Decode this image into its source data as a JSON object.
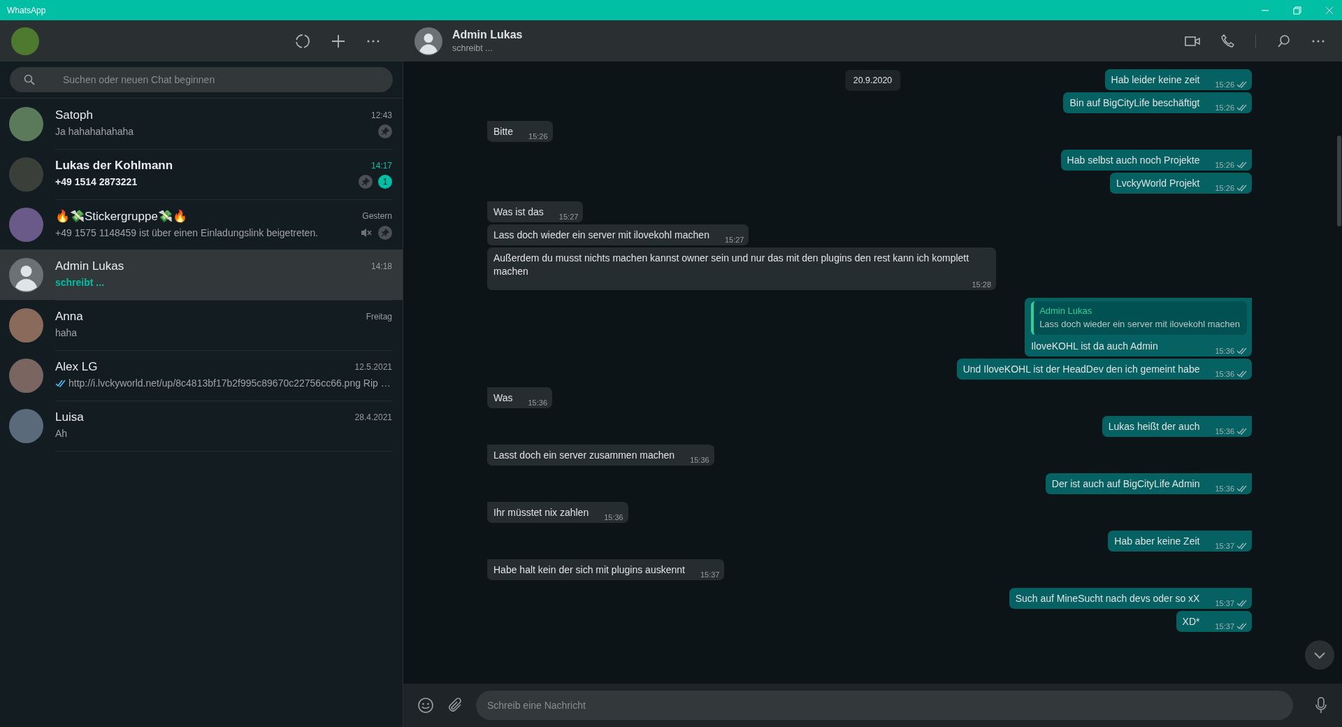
{
  "window": {
    "title": "WhatsApp"
  },
  "sidebar": {
    "search": {
      "placeholder": "Suchen oder neuen Chat beginnen"
    },
    "chats": [
      {
        "name": "Satoph",
        "time": "12:43",
        "preview": "Ja hahahahahaha",
        "photo": true,
        "unread": false,
        "pinned": true,
        "muted": false,
        "selected": false,
        "typing": false,
        "read": false
      },
      {
        "name": "Lukas der Kohlmann",
        "time": "14:17",
        "preview": "+49 1514 2873221",
        "photo": true,
        "unread": true,
        "badge": "1",
        "pinned": true,
        "muted": false,
        "selected": false,
        "typing": false,
        "read": false
      },
      {
        "name": "🔥💸Stickergruppe💸🔥",
        "time": "Gestern",
        "preview": "+49 1575 1148459 ist über einen Einladungslink beigetreten.",
        "photo": true,
        "unread": false,
        "pinned": true,
        "muted": true,
        "selected": false,
        "typing": false,
        "read": false
      },
      {
        "name": "Admin Lukas",
        "time": "14:18",
        "preview": "schreibt ...",
        "photo": false,
        "unread": false,
        "pinned": false,
        "muted": false,
        "selected": true,
        "typing": true,
        "read": false
      },
      {
        "name": "Anna",
        "time": "Freitag",
        "preview": "haha",
        "photo": true,
        "unread": false,
        "pinned": false,
        "muted": false,
        "selected": false,
        "typing": false,
        "read": false
      },
      {
        "name": "Alex LG",
        "time": "12.5.2021",
        "preview": "http://i.lvckyworld.net/up/8c4813bf17b2f995c89670c22756cc66.png Rip …",
        "photo": true,
        "unread": false,
        "pinned": false,
        "muted": false,
        "selected": false,
        "typing": false,
        "read": true
      },
      {
        "name": "Luisa",
        "time": "28.4.2021",
        "preview": "Ah",
        "photo": true,
        "unread": false,
        "pinned": false,
        "muted": false,
        "selected": false,
        "typing": false,
        "read": false
      }
    ]
  },
  "chat": {
    "contact": {
      "name": "Admin Lukas",
      "status": "schreibt ..."
    },
    "date": "20.9.2020",
    "messages": [
      {
        "outgoing": true,
        "text": "Hab leider keine zeit",
        "time": "15:26",
        "tail": false,
        "read": false
      },
      {
        "outgoing": true,
        "text": "Bin auf BigCityLife beschäftigt",
        "time": "15:26",
        "tail": false,
        "read": false
      },
      {
        "outgoing": false,
        "text": "Bitte",
        "time": "15:26",
        "tail": true
      },
      {
        "outgoing": true,
        "text": "Hab selbst auch noch Projekte",
        "time": "15:26",
        "tail": true,
        "read": false
      },
      {
        "outgoing": true,
        "text": "LvckyWorld Projekt",
        "time": "15:26",
        "tail": false,
        "read": false
      },
      {
        "outgoing": false,
        "text": "Was ist das",
        "time": "15:27",
        "tail": true
      },
      {
        "outgoing": false,
        "text": "Lass doch wieder ein server mit ilovekohl machen",
        "time": "15:27",
        "tail": false
      },
      {
        "outgoing": false,
        "text": "Außerdem du musst nichts machen kannst owner sein und nur das mit den plugins den rest kann ich komplett machen",
        "time": "15:28",
        "tail": false
      },
      {
        "outgoing": true,
        "text": "IloveKOHL ist da auch Admin",
        "time": "15:36",
        "tail": true,
        "read": false,
        "reply": {
          "author": "Admin Lukas",
          "text": "Lass doch wieder ein server mit ilovekohl machen"
        }
      },
      {
        "outgoing": true,
        "text": "Und IloveKOHL ist der HeadDev den ich gemeint habe",
        "time": "15:36",
        "tail": false,
        "read": false
      },
      {
        "outgoing": false,
        "text": "Was",
        "time": "15:36",
        "tail": true
      },
      {
        "outgoing": true,
        "text": "Lukas heißt der auch",
        "time": "15:36",
        "tail": true,
        "read": false
      },
      {
        "outgoing": false,
        "text": "Lasst doch ein server zusammen machen",
        "time": "15:36",
        "tail": true
      },
      {
        "outgoing": true,
        "text": "Der ist auch auf BigCityLife Admin",
        "time": "15:36",
        "tail": true,
        "read": false
      },
      {
        "outgoing": false,
        "text": "Ihr müsstet nix zahlen",
        "time": "15:36",
        "tail": true
      },
      {
        "outgoing": true,
        "text": "Hab aber keine Zeit",
        "time": "15:37",
        "tail": true,
        "read": false
      },
      {
        "outgoing": false,
        "text": "Habe halt kein der sich mit plugins auskennt",
        "time": "15:37",
        "tail": true
      },
      {
        "outgoing": true,
        "text": "Such auf MineSucht nach devs oder so xX",
        "time": "15:37",
        "tail": true,
        "read": false
      },
      {
        "outgoing": true,
        "text": "XD*",
        "time": "15:37",
        "tail": false,
        "read": false
      }
    ],
    "composer": {
      "placeholder": "Schreib eine Nachricht"
    }
  }
}
